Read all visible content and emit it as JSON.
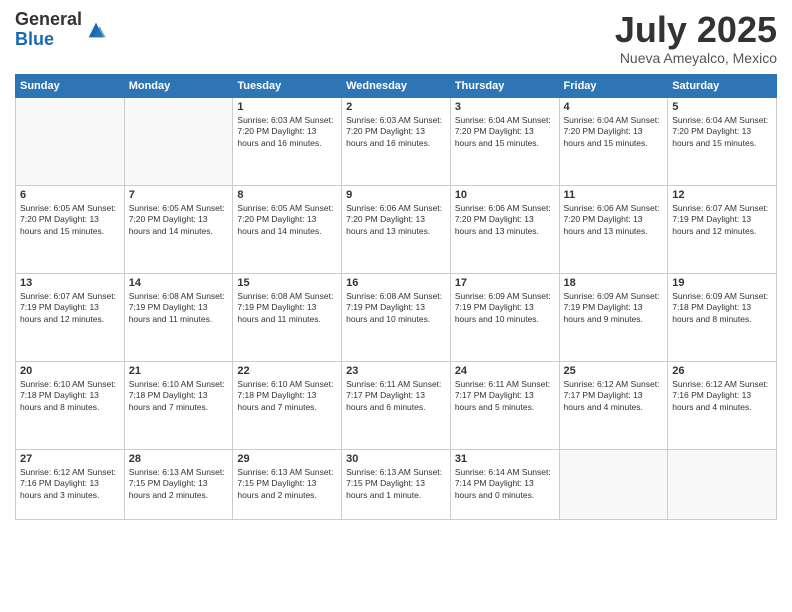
{
  "logo": {
    "general": "General",
    "blue": "Blue"
  },
  "title": "July 2025",
  "location": "Nueva Ameyalco, Mexico",
  "weekdays": [
    "Sunday",
    "Monday",
    "Tuesday",
    "Wednesday",
    "Thursday",
    "Friday",
    "Saturday"
  ],
  "weeks": [
    [
      {
        "day": "",
        "info": ""
      },
      {
        "day": "",
        "info": ""
      },
      {
        "day": "1",
        "info": "Sunrise: 6:03 AM\nSunset: 7:20 PM\nDaylight: 13 hours\nand 16 minutes."
      },
      {
        "day": "2",
        "info": "Sunrise: 6:03 AM\nSunset: 7:20 PM\nDaylight: 13 hours\nand 16 minutes."
      },
      {
        "day": "3",
        "info": "Sunrise: 6:04 AM\nSunset: 7:20 PM\nDaylight: 13 hours\nand 15 minutes."
      },
      {
        "day": "4",
        "info": "Sunrise: 6:04 AM\nSunset: 7:20 PM\nDaylight: 13 hours\nand 15 minutes."
      },
      {
        "day": "5",
        "info": "Sunrise: 6:04 AM\nSunset: 7:20 PM\nDaylight: 13 hours\nand 15 minutes."
      }
    ],
    [
      {
        "day": "6",
        "info": "Sunrise: 6:05 AM\nSunset: 7:20 PM\nDaylight: 13 hours\nand 15 minutes."
      },
      {
        "day": "7",
        "info": "Sunrise: 6:05 AM\nSunset: 7:20 PM\nDaylight: 13 hours\nand 14 minutes."
      },
      {
        "day": "8",
        "info": "Sunrise: 6:05 AM\nSunset: 7:20 PM\nDaylight: 13 hours\nand 14 minutes."
      },
      {
        "day": "9",
        "info": "Sunrise: 6:06 AM\nSunset: 7:20 PM\nDaylight: 13 hours\nand 13 minutes."
      },
      {
        "day": "10",
        "info": "Sunrise: 6:06 AM\nSunset: 7:20 PM\nDaylight: 13 hours\nand 13 minutes."
      },
      {
        "day": "11",
        "info": "Sunrise: 6:06 AM\nSunset: 7:20 PM\nDaylight: 13 hours\nand 13 minutes."
      },
      {
        "day": "12",
        "info": "Sunrise: 6:07 AM\nSunset: 7:19 PM\nDaylight: 13 hours\nand 12 minutes."
      }
    ],
    [
      {
        "day": "13",
        "info": "Sunrise: 6:07 AM\nSunset: 7:19 PM\nDaylight: 13 hours\nand 12 minutes."
      },
      {
        "day": "14",
        "info": "Sunrise: 6:08 AM\nSunset: 7:19 PM\nDaylight: 13 hours\nand 11 minutes."
      },
      {
        "day": "15",
        "info": "Sunrise: 6:08 AM\nSunset: 7:19 PM\nDaylight: 13 hours\nand 11 minutes."
      },
      {
        "day": "16",
        "info": "Sunrise: 6:08 AM\nSunset: 7:19 PM\nDaylight: 13 hours\nand 10 minutes."
      },
      {
        "day": "17",
        "info": "Sunrise: 6:09 AM\nSunset: 7:19 PM\nDaylight: 13 hours\nand 10 minutes."
      },
      {
        "day": "18",
        "info": "Sunrise: 6:09 AM\nSunset: 7:19 PM\nDaylight: 13 hours\nand 9 minutes."
      },
      {
        "day": "19",
        "info": "Sunrise: 6:09 AM\nSunset: 7:18 PM\nDaylight: 13 hours\nand 8 minutes."
      }
    ],
    [
      {
        "day": "20",
        "info": "Sunrise: 6:10 AM\nSunset: 7:18 PM\nDaylight: 13 hours\nand 8 minutes."
      },
      {
        "day": "21",
        "info": "Sunrise: 6:10 AM\nSunset: 7:18 PM\nDaylight: 13 hours\nand 7 minutes."
      },
      {
        "day": "22",
        "info": "Sunrise: 6:10 AM\nSunset: 7:18 PM\nDaylight: 13 hours\nand 7 minutes."
      },
      {
        "day": "23",
        "info": "Sunrise: 6:11 AM\nSunset: 7:17 PM\nDaylight: 13 hours\nand 6 minutes."
      },
      {
        "day": "24",
        "info": "Sunrise: 6:11 AM\nSunset: 7:17 PM\nDaylight: 13 hours\nand 5 minutes."
      },
      {
        "day": "25",
        "info": "Sunrise: 6:12 AM\nSunset: 7:17 PM\nDaylight: 13 hours\nand 4 minutes."
      },
      {
        "day": "26",
        "info": "Sunrise: 6:12 AM\nSunset: 7:16 PM\nDaylight: 13 hours\nand 4 minutes."
      }
    ],
    [
      {
        "day": "27",
        "info": "Sunrise: 6:12 AM\nSunset: 7:16 PM\nDaylight: 13 hours\nand 3 minutes."
      },
      {
        "day": "28",
        "info": "Sunrise: 6:13 AM\nSunset: 7:15 PM\nDaylight: 13 hours\nand 2 minutes."
      },
      {
        "day": "29",
        "info": "Sunrise: 6:13 AM\nSunset: 7:15 PM\nDaylight: 13 hours\nand 2 minutes."
      },
      {
        "day": "30",
        "info": "Sunrise: 6:13 AM\nSunset: 7:15 PM\nDaylight: 13 hours\nand 1 minute."
      },
      {
        "day": "31",
        "info": "Sunrise: 6:14 AM\nSunset: 7:14 PM\nDaylight: 13 hours\nand 0 minutes."
      },
      {
        "day": "",
        "info": ""
      },
      {
        "day": "",
        "info": ""
      }
    ]
  ]
}
